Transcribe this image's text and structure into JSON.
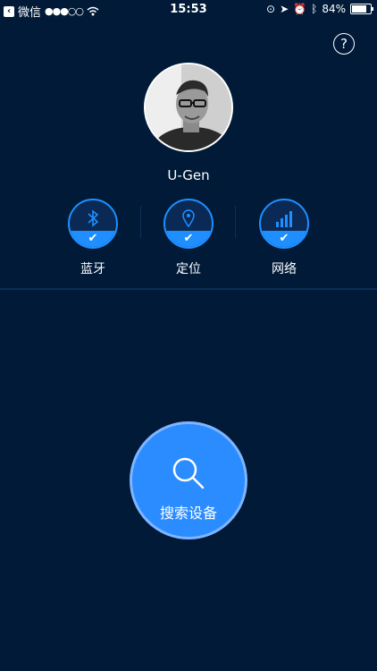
{
  "status_bar": {
    "back_app": "微信",
    "time": "15:53",
    "battery": "84%"
  },
  "profile": {
    "name": "U-Gen"
  },
  "status_items": [
    {
      "label": "蓝牙",
      "icon": "bluetooth-icon",
      "checked": true
    },
    {
      "label": "定位",
      "icon": "location-icon",
      "checked": true
    },
    {
      "label": "网络",
      "icon": "signal-icon",
      "checked": true
    }
  ],
  "search_button": {
    "label": "搜索设备"
  },
  "colors": {
    "background": "#001a38",
    "accent": "#2b8cff",
    "ring": "#1f8fff"
  }
}
